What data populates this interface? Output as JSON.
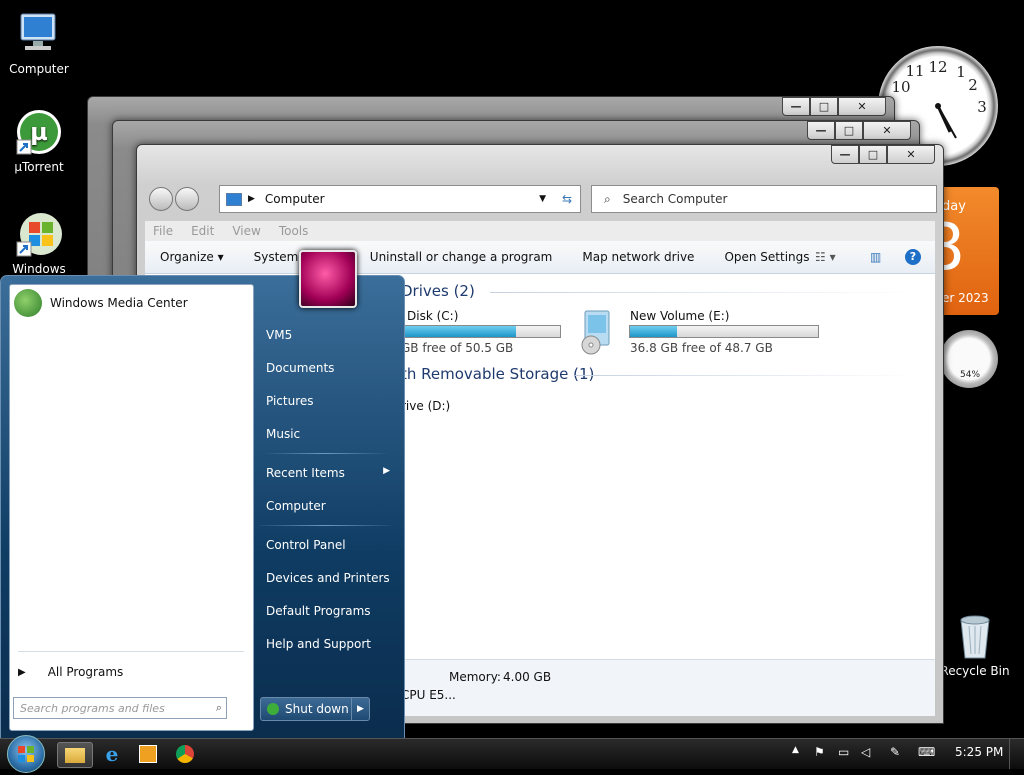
{
  "desktop": {
    "icons": [
      {
        "label": "Computer"
      },
      {
        "label": "µTorrent"
      },
      {
        "label": "Windows"
      },
      {
        "label": "Recycle Bin"
      }
    ]
  },
  "gadgets": {
    "clock_numbers": [
      "12",
      "1",
      "2",
      "3",
      "10",
      "11"
    ],
    "calendar_day": "8",
    "calendar_weekday": "day",
    "calendar_month_year": "er 2023",
    "cpu_percent": "54%"
  },
  "explorer": {
    "address": "Computer",
    "search_placeholder": "Search Computer",
    "menu": [
      "File",
      "Edit",
      "View",
      "Tools"
    ],
    "commands": {
      "organize": "Organize",
      "system_properties": "System p",
      "uninstall": "Uninstall or change a program",
      "map_drive": "Map network drive",
      "open_settings": "Open Settings"
    },
    "group_hdd": "Drives (2)",
    "group_removable": "th Removable Storage (1)",
    "drives": [
      {
        "name": "Disk (C:)",
        "free_text": "GB free of 50.5 GB",
        "used_fraction": 0.72
      },
      {
        "name": "New Volume (E:)",
        "free_text": "36.8 GB free of 48.7 GB",
        "used_fraction": 0.25
      }
    ],
    "removable_drive": "rive (D:)",
    "details": {
      "memory_label": "Memory:",
      "memory_value": "4.00 GB",
      "cpu_text": "CPU E5..."
    }
  },
  "start_menu": {
    "pinned": [
      {
        "label": "Windows Media Center"
      }
    ],
    "all_programs": "All Programs",
    "search_placeholder": "Search programs and files",
    "right_items": [
      {
        "label": "VM5"
      },
      {
        "label": "Documents"
      },
      {
        "label": "Pictures"
      },
      {
        "label": "Music"
      },
      {
        "label": "Recent Items"
      },
      {
        "label": "Computer"
      },
      {
        "label": "Control Panel"
      },
      {
        "label": "Devices and Printers"
      },
      {
        "label": "Default Programs"
      },
      {
        "label": "Help and Support"
      }
    ],
    "shutdown": "Shut down"
  },
  "taskbar": {
    "time": "5:25 PM"
  }
}
